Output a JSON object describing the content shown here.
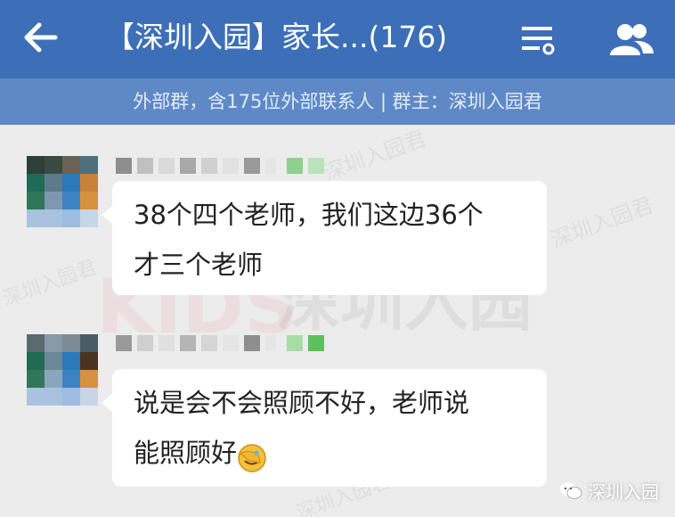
{
  "header": {
    "title": "【深圳入园】家长...(176)"
  },
  "subheader": {
    "text": "外部群，含175位外部联系人 | 群主：深圳入园君"
  },
  "watermarks": {
    "big": "深圳入园",
    "kids": "KIDS",
    "small": "深圳入园君"
  },
  "messages": [
    {
      "line1": "38个四个老师，我们这边36个",
      "line2": "才三个老师"
    },
    {
      "line1": "说是会不会照顾不好，老师说",
      "line2": "能照顾好"
    }
  ],
  "footer": {
    "label": "深圳入园"
  },
  "colors": {
    "header_bg": "#3d6fb8",
    "subheader_bg": "#5e89c6",
    "chat_bg": "#ececec"
  },
  "icons": {
    "back": "arrow-left-icon",
    "menu": "list-settings-icon",
    "members": "group-members-icon",
    "emoji": "facepalm-emoji-icon",
    "footer": "wechat-icon"
  }
}
